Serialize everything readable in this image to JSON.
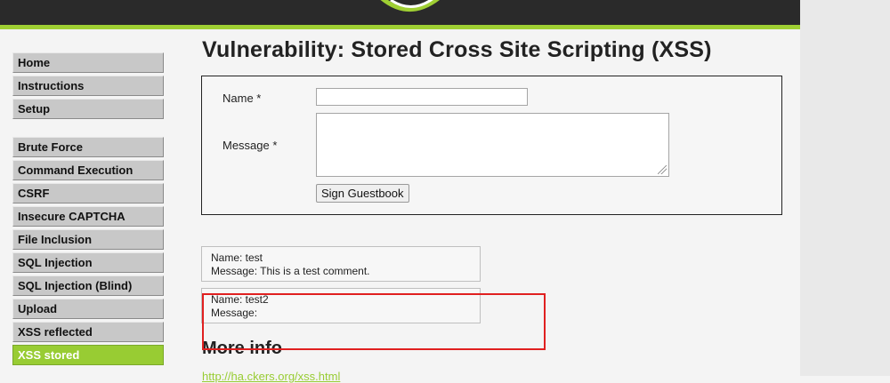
{
  "colors": {
    "accent": "#98cc33",
    "header": "#2a2a2a",
    "annotation": "#e02020"
  },
  "header": {
    "logo_icon": "dvwa-logo-icon"
  },
  "sidebar": {
    "items": [
      {
        "label": "Home"
      },
      {
        "label": "Instructions"
      },
      {
        "label": "Setup"
      },
      {
        "label": "Brute Force"
      },
      {
        "label": "Command Execution"
      },
      {
        "label": "CSRF"
      },
      {
        "label": "Insecure CAPTCHA"
      },
      {
        "label": "File Inclusion"
      },
      {
        "label": "SQL Injection"
      },
      {
        "label": "SQL Injection (Blind)"
      },
      {
        "label": "Upload"
      },
      {
        "label": "XSS reflected"
      },
      {
        "label": "XSS stored",
        "active": true
      }
    ]
  },
  "main": {
    "title": "Vulnerability: Stored Cross Site Scripting (XSS)",
    "form": {
      "name_label": "Name *",
      "name_value": "",
      "message_label": "Message *",
      "message_value": "",
      "submit_label": "Sign Guestbook"
    },
    "entries": [
      {
        "name": "Name: test",
        "message": "Message: This is a test comment."
      },
      {
        "name": "Name: test2",
        "message": "Message:"
      }
    ],
    "more_info_title": "More info",
    "more_info_link": "http://ha.ckers.org/xss.html"
  }
}
